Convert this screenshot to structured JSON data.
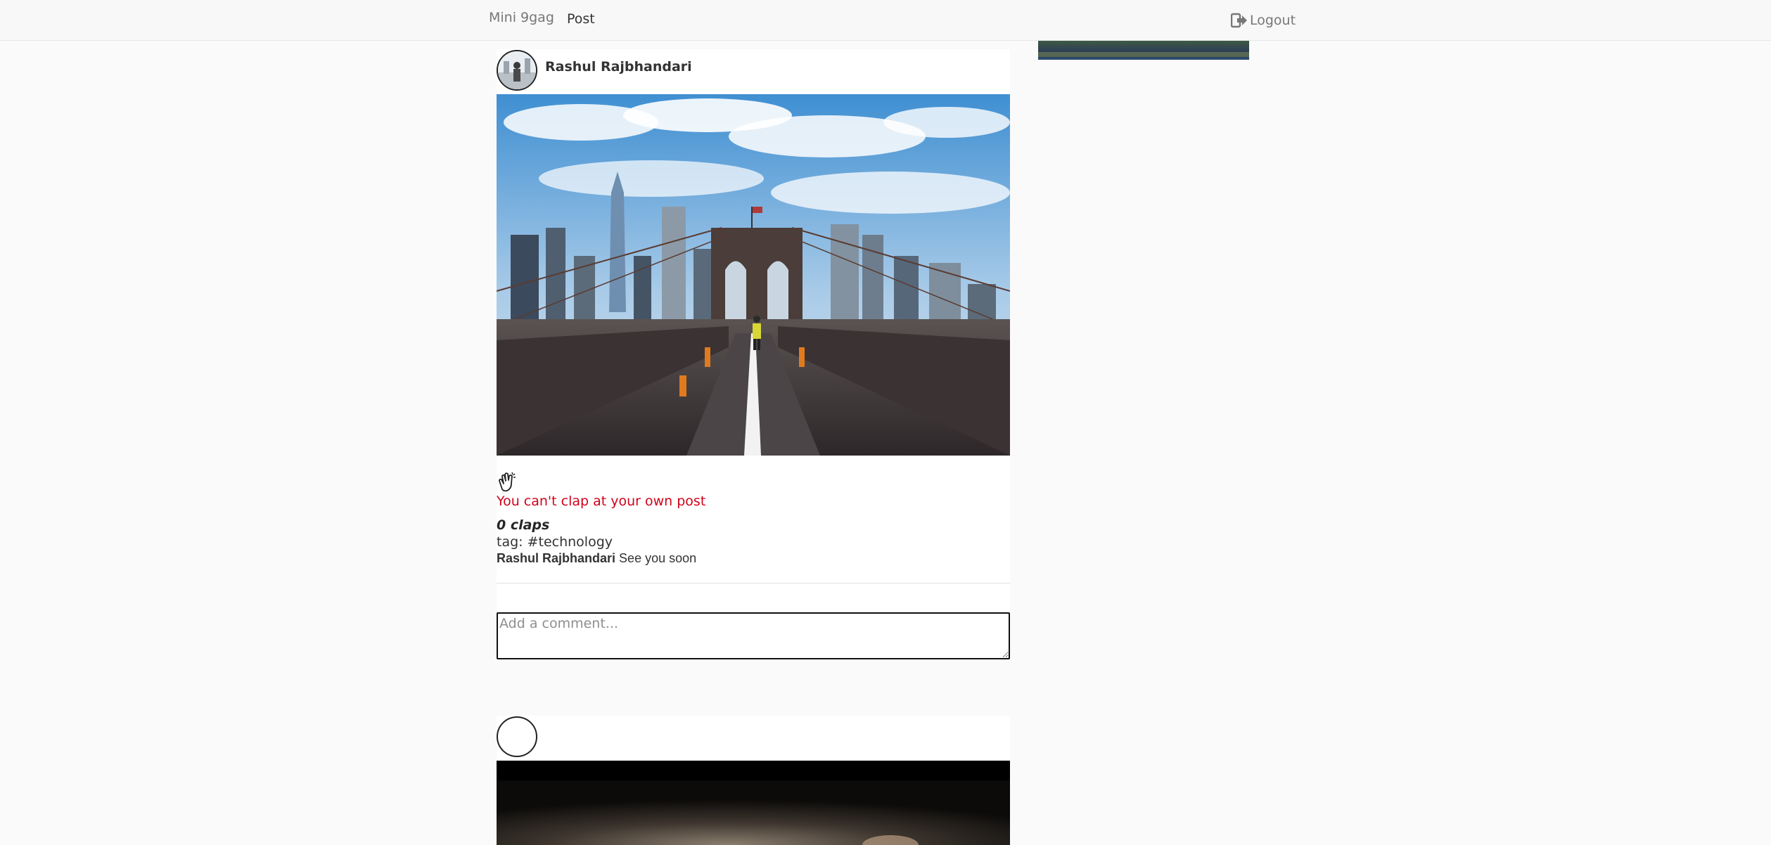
{
  "nav": {
    "brand": "Mini 9gag",
    "post_link": "Post",
    "logout_label": "Logout",
    "logout_icon": "sign-out-icon"
  },
  "posts": [
    {
      "author": "Rashul Rajbhandari",
      "image_alt": "Brooklyn Bridge walkway with Manhattan skyline",
      "clap_icon": "clap-hands-icon",
      "clap_error": "You can't clap at your own post",
      "claps": "0 claps",
      "tag": "tag: #technology",
      "comments": [
        {
          "author": "Rashul Rajbhandari",
          "text": "See you soon"
        }
      ],
      "comment_placeholder": "Add a comment..."
    },
    {
      "author": "",
      "image_alt": "close-up photo of a small animal"
    }
  ],
  "colors": {
    "error": "#d0021b",
    "navbar_bg": "#f8f8f8",
    "page_bg": "#fafafa"
  }
}
